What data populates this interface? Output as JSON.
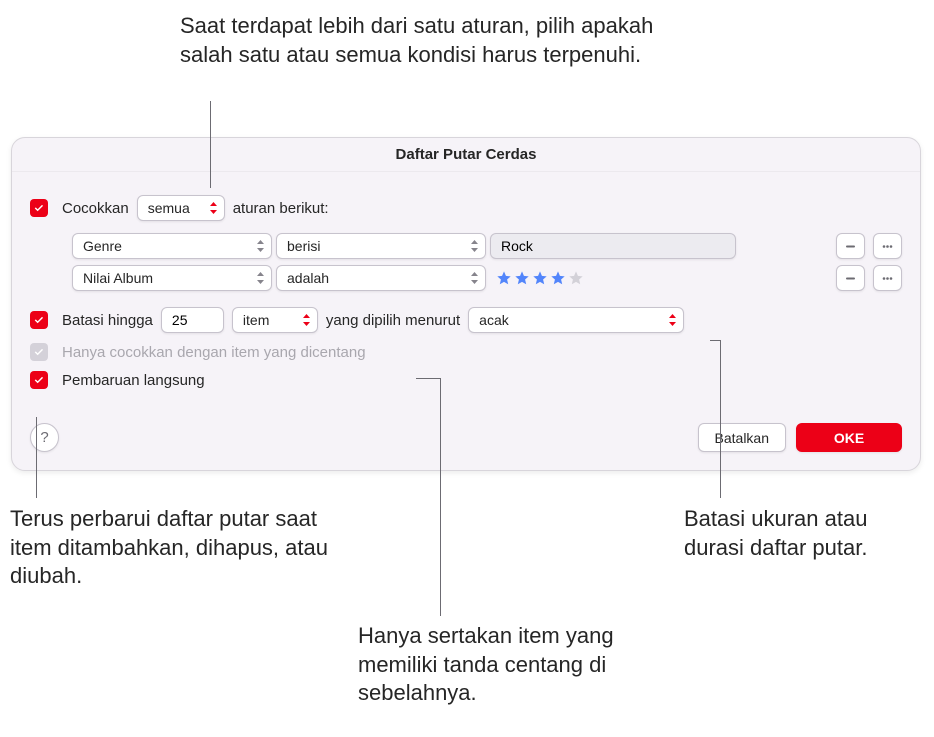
{
  "annotations": {
    "top": "Saat terdapat lebih dari satu aturan, pilih apakah salah satu atau semua kondisi harus terpenuhi.",
    "left": "Terus perbarui daftar putar saat item ditambahkan, dihapus, atau diubah.",
    "right": "Batasi ukuran atau durasi daftar putar.",
    "mid": "Hanya sertakan item yang memiliki tanda centang di sebelahnya."
  },
  "dialog": {
    "title": "Daftar Putar Cerdas",
    "match": {
      "checkbox_label": "Cocokkan",
      "checked": true,
      "mode": "semua",
      "suffix": "aturan berikut:"
    },
    "rules": [
      {
        "field": "Genre",
        "operator": "berisi",
        "value_type": "text",
        "value": "Rock"
      },
      {
        "field": "Nilai Album",
        "operator": "adalah",
        "value_type": "stars",
        "stars_on": 4,
        "stars_total": 5
      }
    ],
    "limit": {
      "checked": true,
      "label": "Batasi hingga",
      "value": "25",
      "unit": "item",
      "selected_by_label": "yang dipilih menurut",
      "selected_by": "acak"
    },
    "only_checked": {
      "checked": true,
      "enabled": false,
      "label": "Hanya cocokkan dengan item yang dicentang"
    },
    "live_update": {
      "checked": true,
      "label": "Pembaruan langsung"
    },
    "buttons": {
      "help": "?",
      "cancel": "Batalkan",
      "ok": "OKE"
    }
  }
}
